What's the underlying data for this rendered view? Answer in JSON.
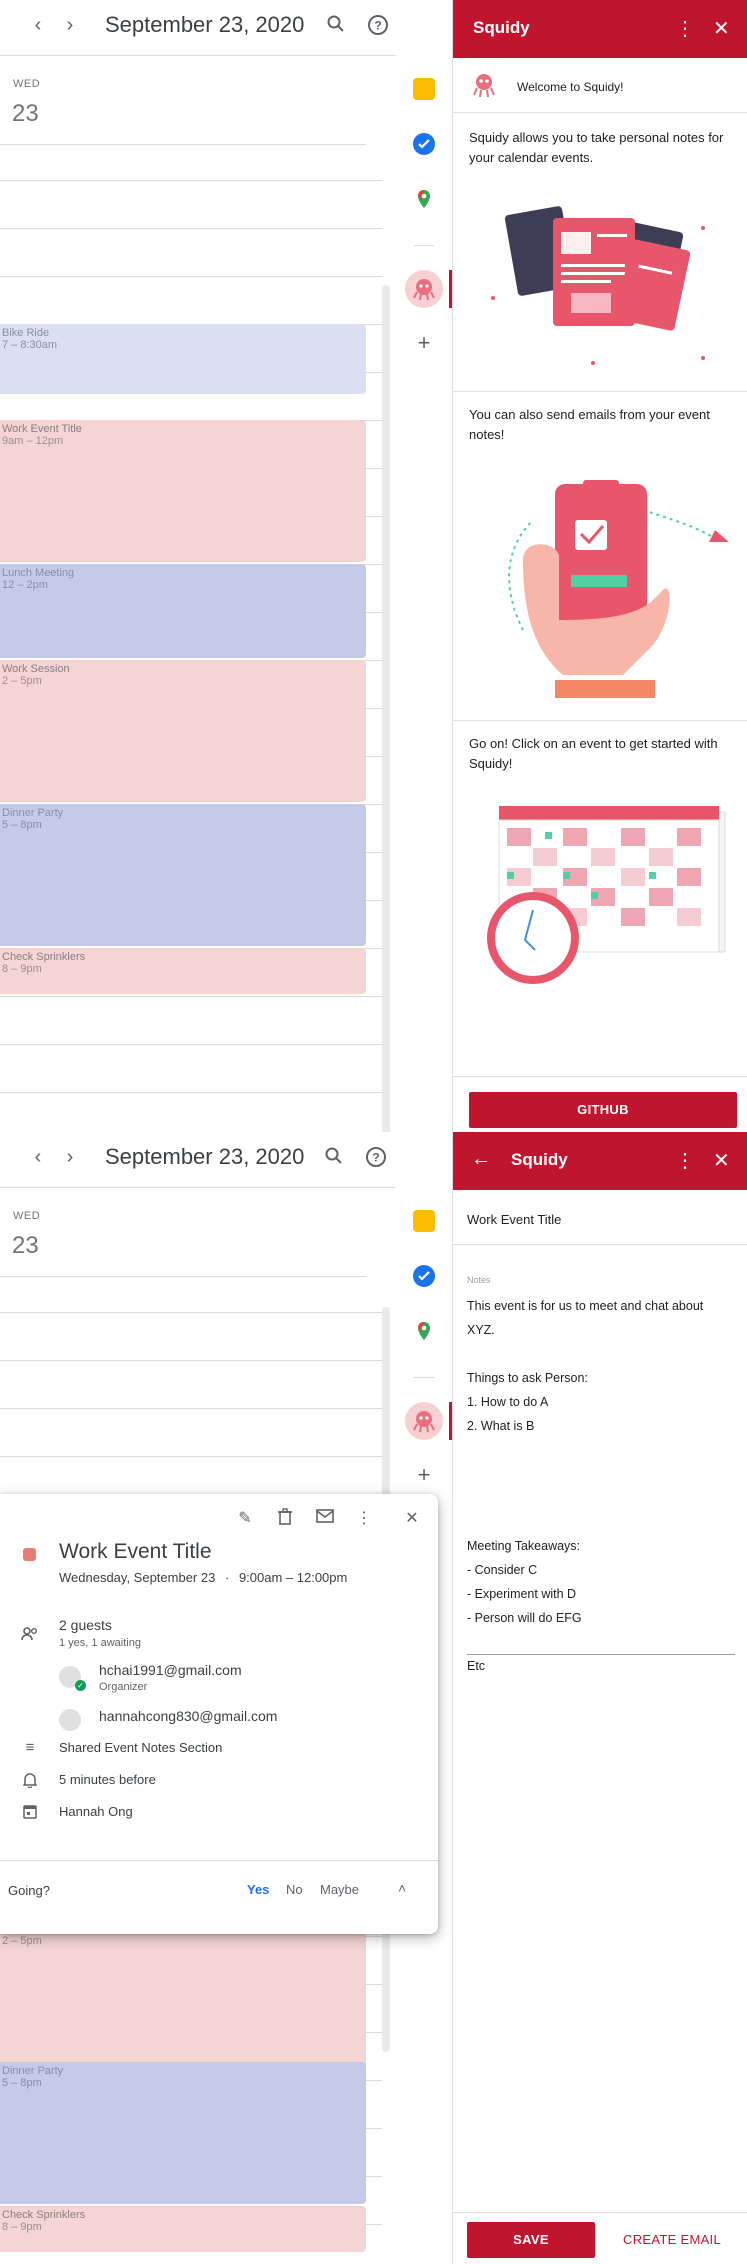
{
  "header": {
    "prev_icon": "chevron-left-icon",
    "next_icon": "chevron-right-icon",
    "date_title": "September 23, 2020",
    "search_icon": "search-icon",
    "help_icon": "help-icon",
    "settings_icon": "gear-icon"
  },
  "day": {
    "dow": "WED",
    "dom": "23"
  },
  "events": [
    {
      "title": "Bike Ride",
      "time": "7 – 8:30am",
      "color": "#dadff2"
    },
    {
      "title": "Work Event Title",
      "time": "9am – 12pm",
      "color": "#f5d5d3"
    },
    {
      "title": "Lunch Meeting",
      "time": "12 – 2pm",
      "color": "#c5cae9"
    },
    {
      "title": "Work Session",
      "time": "2 – 5pm",
      "color": "#f5d5d3"
    },
    {
      "title": "Dinner Party",
      "time": "5 – 8pm",
      "color": "#c5cae9"
    },
    {
      "title": "Check Sprinklers",
      "time": "8 – 9pm",
      "color": "#f5d5d3"
    }
  ],
  "rail": {
    "keep_icon": "keep-icon",
    "tasks_icon": "tasks-icon",
    "maps_icon": "maps-icon",
    "squidy_icon": "squidy-icon",
    "add_icon": "plus-icon"
  },
  "squidy_welcome": {
    "title": "Squidy",
    "welcome": "Welcome to Squidy!",
    "para1": "Squidy allows you to take personal notes for your calendar events.",
    "para2": "You can also send emails from your event notes!",
    "para3": "Go on! Click on an event to get started with Squidy!",
    "github_button": "GITHUB"
  },
  "squidy_note": {
    "title": "Squidy",
    "event_title": "Work Event Title",
    "notes_label": "Notes",
    "notes_lines": [
      "This event is for us to meet and chat about",
      "XYZ.",
      "",
      "Things to ask Person:",
      "1. How to do A",
      "2. What is B",
      "",
      "",
      "",
      "",
      "Meeting Takeaways:",
      "- Consider C",
      "- Experiment with D",
      "- Person will do EFG",
      "",
      "Etc"
    ],
    "save_button": "SAVE",
    "email_button": "CREATE EMAIL"
  },
  "popup": {
    "title": "Work Event Title",
    "date": "Wednesday, September 23",
    "dot": "·",
    "time": "9:00am – 12:00pm",
    "guests_count": "2 guests",
    "guests_status": "1 yes, 1 awaiting",
    "guests": [
      {
        "email": "hchai1991@gmail.com",
        "role": "Organizer"
      },
      {
        "email": "hannahcong830@gmail.com",
        "role": ""
      }
    ],
    "description": "Shared Event Notes Section",
    "reminder": "5 minutes before",
    "calendar": "Hannah Ong",
    "going_label": "Going?",
    "yes": "Yes",
    "no": "No",
    "maybe": "Maybe",
    "event_color": "#e67c73",
    "accent": "#1a73e8"
  }
}
